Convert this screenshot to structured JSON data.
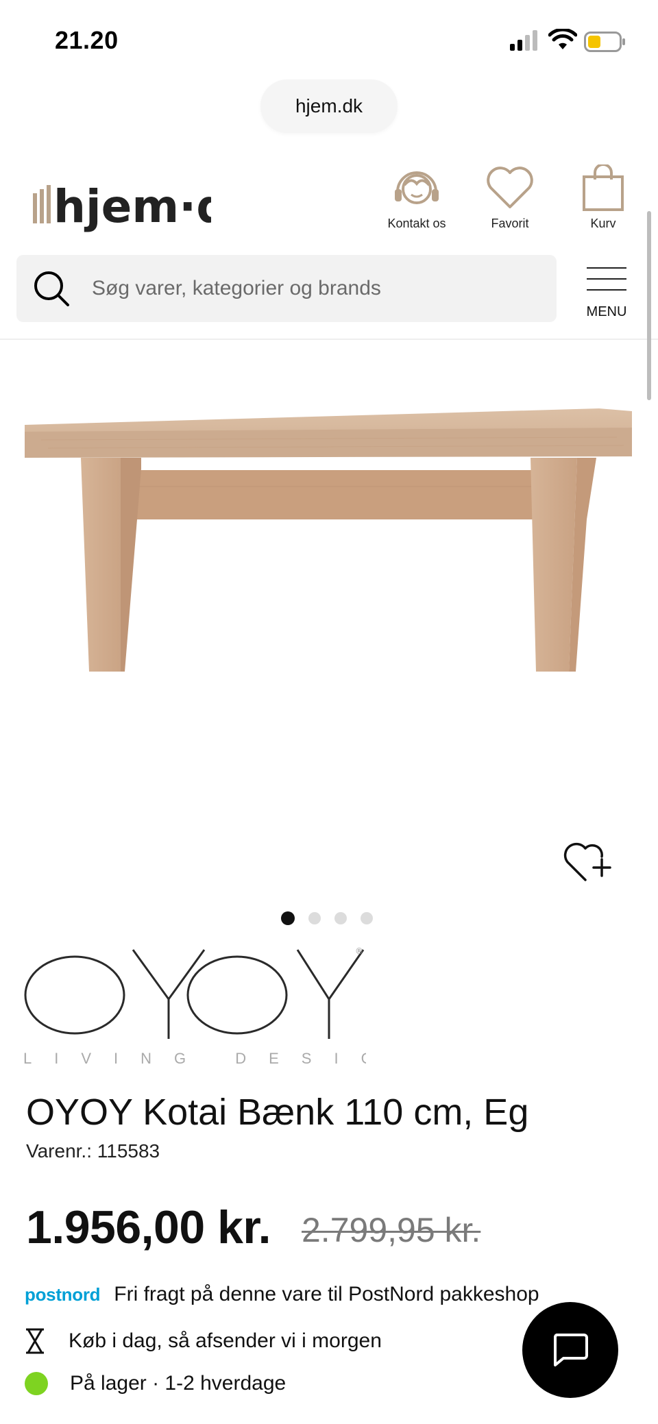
{
  "status_bar": {
    "time": "21.20"
  },
  "browser": {
    "url": "hjem.dk"
  },
  "header": {
    "logo_text": "hjem·dk",
    "nav": {
      "contact_label": "Kontakt os",
      "favorite_label": "Favorit",
      "cart_label": "Kurv"
    },
    "search": {
      "placeholder": "Søg varer, kategorier og brands"
    },
    "menu_label": "MENU"
  },
  "gallery": {
    "image_count": 4,
    "active_index": 0
  },
  "brand": {
    "name": "OYOY",
    "tagline": "LIVING DESIGN"
  },
  "product": {
    "title": "OYOY Kotai Bænk 110 cm, Eg",
    "sku": "Varenr.: 115583",
    "price": "1.956,00 kr.",
    "old_price": "2.799,95 kr.",
    "shipping_logo": "postnord",
    "shipping_text": "Fri fragt på denne vare til PostNord pakkeshop",
    "dispatch_text": "Køb i dag, så afsender vi i morgen",
    "stock_text": "På lager · 1-2 hverdage"
  },
  "icons": {
    "contact": "headset-icon",
    "favorite": "heart-icon",
    "cart": "shopping-bag-icon",
    "search": "search-icon",
    "menu": "hamburger-icon",
    "add_favorite": "heart-plus-icon",
    "dispatch": "hourglass-icon",
    "chat": "chat-bubble-icon"
  },
  "colors": {
    "logo_accent": "#b8a28a",
    "postnord_blue": "#00a0d6",
    "in_stock_green": "#7ed321",
    "wood": "#d9b89c"
  }
}
